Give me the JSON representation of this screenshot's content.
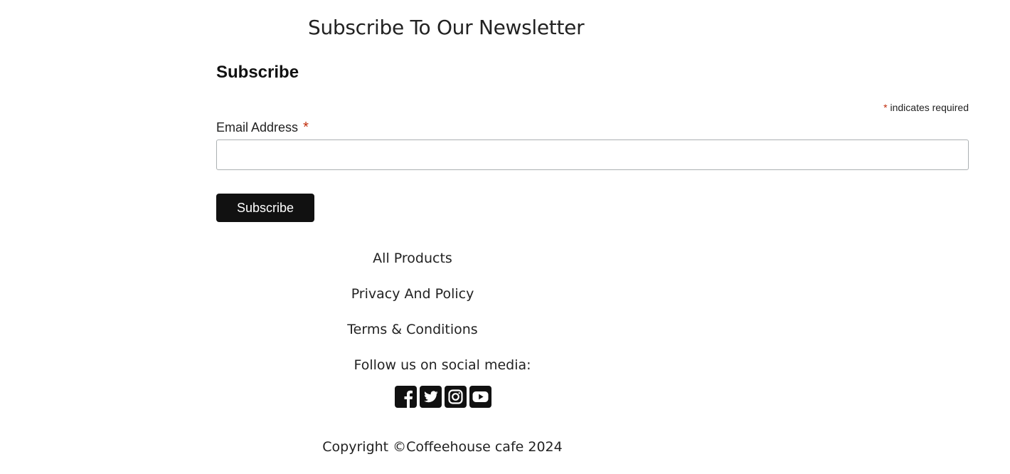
{
  "newsletter": {
    "heading": "Subscribe To Our Newsletter"
  },
  "form": {
    "title": "Subscribe",
    "required_asterisk": "*",
    "required_note": "indicates required",
    "email_label": "Email Address",
    "email_required_asterisk": "*",
    "email_value": "",
    "email_placeholder": "",
    "submit_label": "Subscribe"
  },
  "footer": {
    "links": [
      {
        "label": "All Products"
      },
      {
        "label": "Privacy And Policy"
      },
      {
        "label": "Terms & Conditions"
      }
    ],
    "social_heading": "Follow us on social media:",
    "social_icons": [
      "facebook-icon",
      "twitter-icon",
      "instagram-icon",
      "youtube-icon"
    ],
    "copyright": "Copyright ©Coffeehouse cafe 2024"
  },
  "colors": {
    "button_bg": "#111111",
    "button_text": "#ffffff",
    "required_asterisk": "#c02b0a",
    "text": "#222222",
    "input_border": "#abb0b2"
  }
}
